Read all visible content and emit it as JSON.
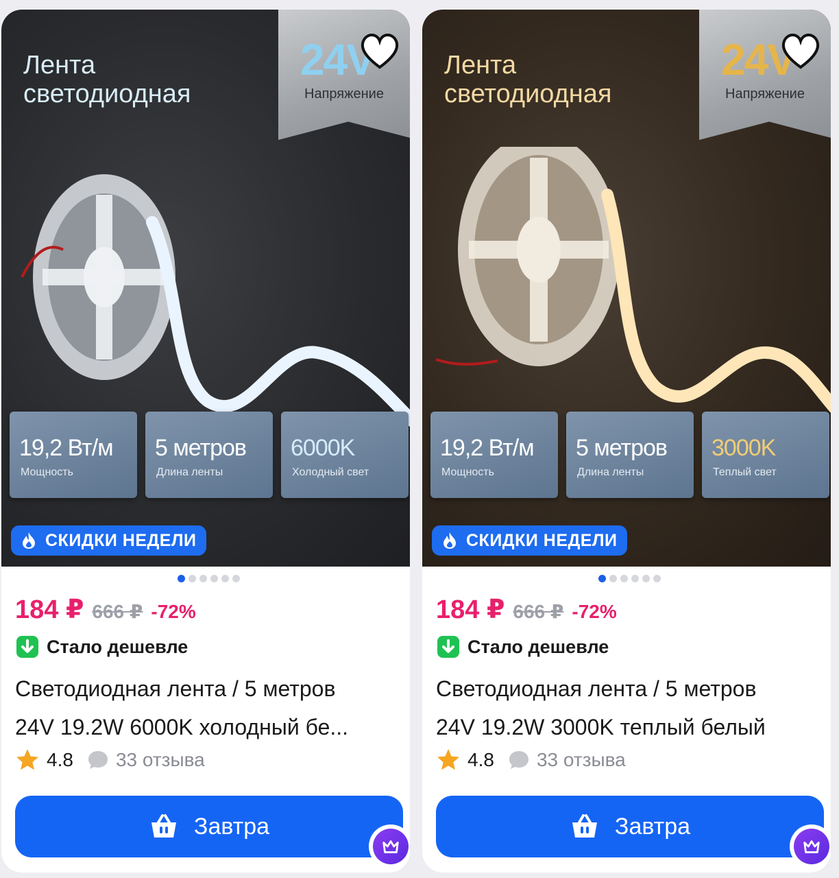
{
  "products": [
    {
      "headline_line1": "Лента",
      "headline_line2": "светодиодная",
      "voltage_value": "24V",
      "voltage_label": "Напряжение",
      "specs": [
        {
          "value": "19,2 Вт/м",
          "label": "Мощность"
        },
        {
          "value": "5 метров",
          "label": "Длина ленты"
        },
        {
          "value": "6000K",
          "label": "Холодный свет"
        }
      ],
      "promo_label": "СКИДКИ НЕДЕЛИ",
      "price": "184 ₽",
      "old_price": "666 ₽",
      "discount": "-72%",
      "cheaper_label": "Стало дешевле",
      "title_line1": "Светодиодная лента / 5 метров",
      "title_line2": "24V 19.2W 6000K холодный бе...",
      "rating": "4.8",
      "reviews": "33 отзыва",
      "buy_label": "Завтра",
      "light_color": "#eaf4ff"
    },
    {
      "headline_line1": "Лента",
      "headline_line2": "светодиодная",
      "voltage_value": "24V",
      "voltage_label": "Напряжение",
      "specs": [
        {
          "value": "19,2 Вт/м",
          "label": "Мощность"
        },
        {
          "value": "5 метров",
          "label": "Длина ленты"
        },
        {
          "value": "3000K",
          "label": "Теплый свет"
        }
      ],
      "promo_label": "СКИДКИ НЕДЕЛИ",
      "price": "184 ₽",
      "old_price": "666 ₽",
      "discount": "-72%",
      "cheaper_label": "Стало дешевле",
      "title_line1": "Светодиодная лента / 5 метров",
      "title_line2": "24V 19.2W 3000K теплый белый",
      "rating": "4.8",
      "reviews": "33 отзыва",
      "buy_label": "Завтра",
      "light_color": "#ffe6b8"
    }
  ],
  "gallery": {
    "total_images": 6,
    "active_image": 1
  },
  "colors": {
    "price": "#e8206c",
    "accent_blue": "#1565f5",
    "promo_blue": "#1e6cf0",
    "cheaper_green": "#1fc252",
    "star": "#f5a623"
  },
  "icons": [
    "heart-icon",
    "fire-icon",
    "arrow-down-icon",
    "star-icon",
    "comment-icon",
    "basket-icon",
    "crown-icon"
  ]
}
